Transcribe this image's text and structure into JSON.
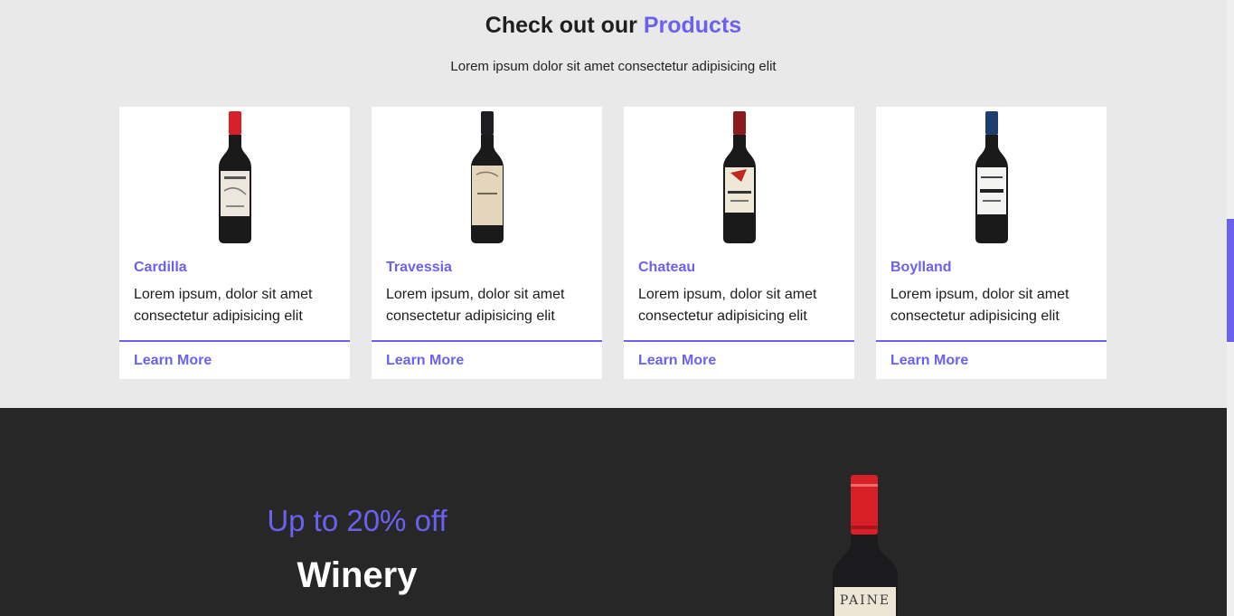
{
  "products": {
    "title_prefix": "Check out our",
    "title_accent": "Products",
    "subtitle": "Lorem ipsum dolor sit amet consectetur adipisicing elit",
    "items": [
      {
        "name": "Cardilla",
        "description": "Lorem ipsum, dolor sit amet consectetur adipisicing elit",
        "cta": "Learn More",
        "cap_color": "#d8202b",
        "label_color": "#ece6dc"
      },
      {
        "name": "Travessia",
        "description": "Lorem ipsum, dolor sit amet consectetur adipisicing elit",
        "cta": "Learn More",
        "cap_color": "#1e1e22",
        "label_color": "#e4d6bd"
      },
      {
        "name": "Chateau",
        "description": "Lorem ipsum, dolor sit amet consectetur adipisicing elit",
        "cta": "Learn More",
        "cap_color": "#8a1b1f",
        "label_color": "#efe8d8"
      },
      {
        "name": "Boylland",
        "description": "Lorem ipsum, dolor sit amet consectetur adipisicing elit",
        "cta": "Learn More",
        "cap_color": "#1c3f6e",
        "label_color": "#f3f3f1"
      }
    ]
  },
  "promo": {
    "discount": "Up to 20% off",
    "brand": "Winery",
    "bottle_label": "PAINE"
  },
  "colors": {
    "accent": "#6b61f0",
    "dark_bg": "#272727",
    "light_bg": "#e9e9e9"
  }
}
